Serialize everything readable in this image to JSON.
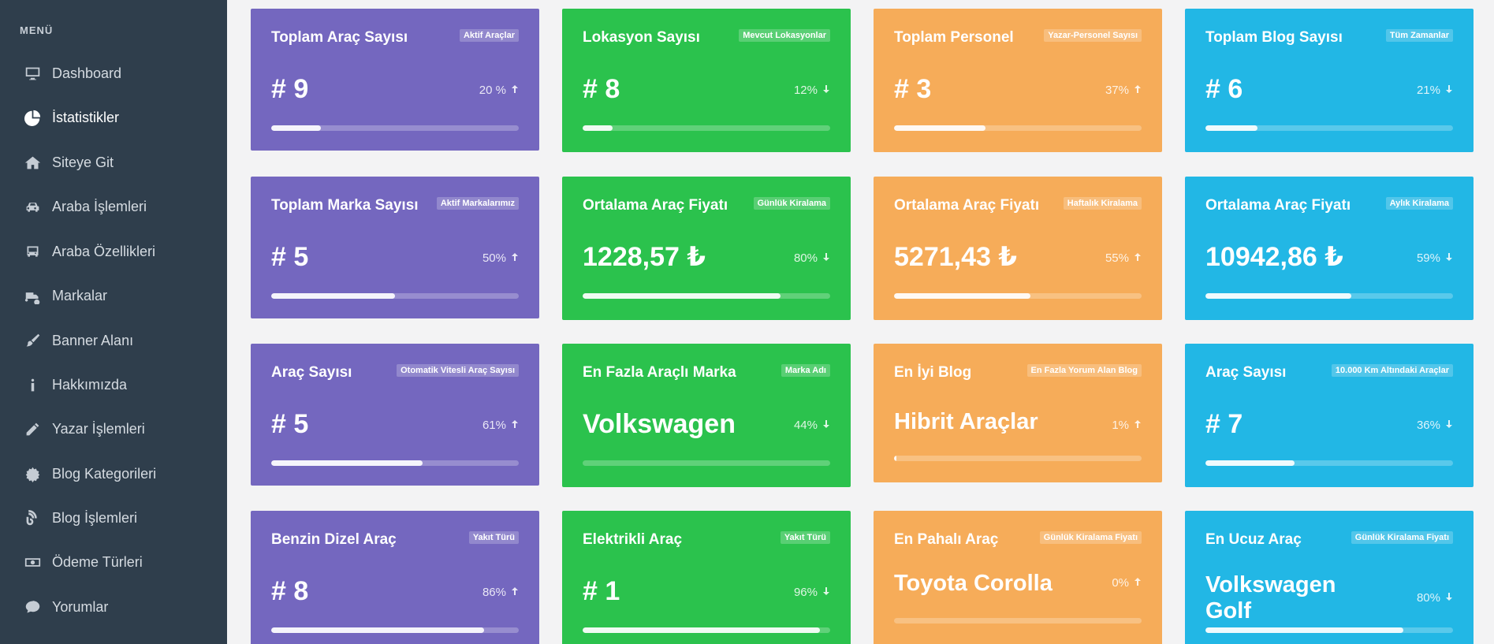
{
  "sidebar": {
    "menu_title": "MENÜ",
    "items": [
      {
        "label": "Dashboard",
        "icon": "monitor-icon"
      },
      {
        "label": "İstatistikler",
        "icon": "pie-chart-icon",
        "active": true
      },
      {
        "label": "Siteye Git",
        "icon": "home-icon"
      },
      {
        "label": "Araba İşlemleri",
        "icon": "car-icon"
      },
      {
        "label": "Araba Özellikleri",
        "icon": "bus-icon"
      },
      {
        "label": "Markalar",
        "icon": "truck-clock-icon"
      },
      {
        "label": "Banner Alanı",
        "icon": "brush-icon"
      },
      {
        "label": "Hakkımızda",
        "icon": "info-icon"
      },
      {
        "label": "Yazar İşlemleri",
        "icon": "pencil-icon"
      },
      {
        "label": "Blog Kategorileri",
        "icon": "certificate-icon"
      },
      {
        "label": "Blog İşlemleri",
        "icon": "blog-icon"
      },
      {
        "label": "Ödeme Türleri",
        "icon": "money-bill-icon"
      },
      {
        "label": "Yorumlar",
        "icon": "comment-icon"
      }
    ]
  },
  "cards": [
    {
      "title": "Toplam Araç Sayısı",
      "badge": "Aktif Araçlar",
      "value": "# 9",
      "percent": "20 %",
      "direction": "up",
      "progress": 0.2,
      "color": "purple"
    },
    {
      "title": "Lokasyon Sayısı",
      "badge": "Mevcut Lokasyonlar",
      "value": "# 8",
      "percent": "12%",
      "direction": "down",
      "progress": 0.12,
      "color": "green"
    },
    {
      "title": "Toplam Personel",
      "badge": "Yazar-Personel Sayısı",
      "value": "# 3",
      "percent": "37%",
      "direction": "up",
      "progress": 0.37,
      "color": "orange"
    },
    {
      "title": "Toplam Blog Sayısı",
      "badge": "Tüm Zamanlar",
      "value": "# 6",
      "percent": "21%",
      "direction": "down",
      "progress": 0.21,
      "color": "blue"
    },
    {
      "title": "Toplam Marka Sayısı",
      "badge": "Aktif Markalarımız",
      "value": "# 5",
      "percent": "50%",
      "direction": "up",
      "progress": 0.5,
      "color": "purple"
    },
    {
      "title": "Ortalama Araç Fiyatı",
      "badge": "Günlük Kiralama",
      "value": "1228,57 ₺",
      "percent": "80%",
      "direction": "down",
      "progress": 0.8,
      "color": "green"
    },
    {
      "title": "Ortalama Araç Fiyatı",
      "badge": "Haftalık Kiralama",
      "value": "5271,43 ₺",
      "percent": "55%",
      "direction": "up",
      "progress": 0.55,
      "color": "orange"
    },
    {
      "title": "Ortalama Araç Fiyatı",
      "badge": "Aylık Kiralama",
      "value": "10942,86 ₺",
      "percent": "59%",
      "direction": "down",
      "progress": 0.59,
      "color": "blue"
    },
    {
      "title": "Araç Sayısı",
      "badge": "Otomatik Vitesli Araç Sayısı",
      "value": "# 5",
      "percent": "61%",
      "direction": "up",
      "progress": 0.61,
      "color": "purple"
    },
    {
      "title": "En Fazla Araçlı Marka",
      "badge": "Marka Adı",
      "value": "Volkswagen",
      "percent": "44%",
      "direction": "down",
      "progress": 0.0,
      "color": "green"
    },
    {
      "title": "En İyi Blog",
      "badge": "En Fazla Yorum Alan Blog",
      "value": "Hibrit Araçlar",
      "percent": "1%",
      "direction": "up",
      "progress": 0.01,
      "color": "orange"
    },
    {
      "title": "Araç Sayısı",
      "badge": "10.000 Km Altındaki Araçlar",
      "value": "# 7",
      "percent": "36%",
      "direction": "down",
      "progress": 0.36,
      "color": "blue"
    },
    {
      "title": "Benzin Dizel Araç",
      "badge": "Yakıt Türü",
      "value": "# 8",
      "percent": "86%",
      "direction": "up",
      "progress": 0.86,
      "color": "purple"
    },
    {
      "title": "Elektrikli Araç",
      "badge": "Yakıt Türü",
      "value": "# 1",
      "percent": "96%",
      "direction": "down",
      "progress": 0.96,
      "color": "green"
    },
    {
      "title": "En Pahalı Araç",
      "badge": "Günlük Kiralama Fiyatı",
      "value": "Toyota Corolla",
      "percent": "0%",
      "direction": "up",
      "progress": 0.0,
      "color": "orange"
    },
    {
      "title": "En Ucuz Araç",
      "badge": "Günlük Kiralama Fiyatı",
      "value": "Volkswagen Golf",
      "percent": "80%",
      "direction": "down",
      "progress": 0.8,
      "color": "blue"
    }
  ],
  "colors": {
    "purple": "#7467bf",
    "green": "#2bc24d",
    "orange": "#f6ac59",
    "blue": "#22b7e5",
    "sidebar": "#2f3e4c"
  }
}
